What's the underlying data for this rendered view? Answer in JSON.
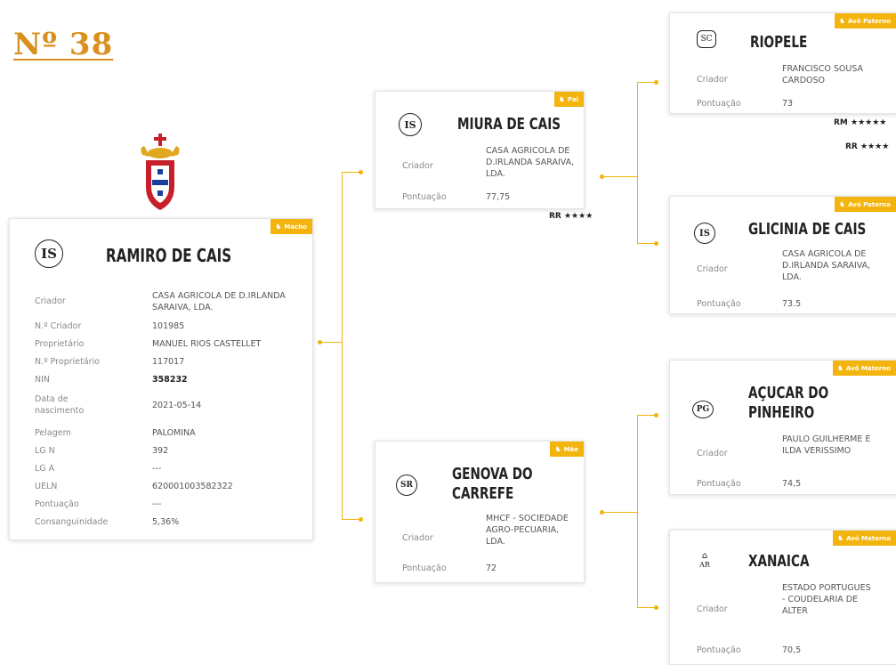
{
  "page_title": "Nº 38",
  "main": {
    "badge": "Macho",
    "name": "RAMIRO DE CAIS",
    "fields": [
      {
        "label": "Criador",
        "value": "CASA AGRICOLA DE D.IRLANDA SARAIVA, LDA."
      },
      {
        "label": "N.º Criador",
        "value": "101985"
      },
      {
        "label": "Proprietário",
        "value": "MANUEL RIOS CASTELLET"
      },
      {
        "label": "N.º Proprietário",
        "value": "117017"
      },
      {
        "label": "NIN",
        "value": "358232"
      },
      {
        "label": "Data de nascimento",
        "value": "2021-05-14"
      },
      {
        "label": "Pelagem",
        "value": "PALOMINA"
      },
      {
        "label": "LG N",
        "value": "392"
      },
      {
        "label": "LG A",
        "value": "---"
      },
      {
        "label": "UELN",
        "value": "620001003582322"
      },
      {
        "label": "Pontuação",
        "value": "---"
      },
      {
        "label": "Consanguinidade",
        "value": "5,36%"
      }
    ],
    "logo": "IS"
  },
  "sire": {
    "badge": "Pai",
    "name": "MIURA DE CAIS",
    "logo": "IS",
    "criador_label": "Criador",
    "criador": "CASA AGRICOLA DE D.IRLANDA SARAIVA, LDA.",
    "pontuacao_label": "Pontuação",
    "pontuacao": "77,75",
    "grade": "RR ★★★★"
  },
  "dam": {
    "badge": "Mãe",
    "name": "GENOVA DO CARREFE",
    "logo": "SR",
    "criador_label": "Criador",
    "criador": "MHCF - SOCIEDADE AGRO-PECUARIA, LDA.",
    "pontuacao_label": "Pontuação",
    "pontuacao": "72"
  },
  "gs1": {
    "badge": "Avô Paterno",
    "name": "RIOPELE",
    "logo": "SC",
    "criador_label": "Criador",
    "criador": "FRANCISCO SOUSA CARDOSO",
    "pontuacao_label": "Pontuação",
    "pontuacao": "73",
    "grade1": "RM ★★★★★",
    "grade2": "RR ★★★★"
  },
  "gd1": {
    "badge": "Avó Paterna",
    "name": "GLICINIA DE CAIS",
    "logo": "IS",
    "criador_label": "Criador",
    "criador": "CASA AGRICOLA DE D.IRLANDA SARAIVA, LDA.",
    "pontuacao_label": "Pontuação",
    "pontuacao": "73.5"
  },
  "gs2": {
    "badge": "Avô Materno",
    "name": "AÇUCAR DO PINHEIRO",
    "logo": "PG",
    "criador_label": "Criador",
    "criador": "PAULO GUILHERME E ILDA VERISSIMO",
    "pontuacao_label": "Pontuação",
    "pontuacao": "74,5"
  },
  "gd2": {
    "badge": "Avó Materna",
    "name": "XANAICA",
    "logo": "AR",
    "criador_label": "Criador",
    "criador": "ESTADO PORTUGUES - COUDELARIA DE ALTER",
    "pontuacao_label": "Pontuação",
    "pontuacao": "70,5"
  },
  "colors": {
    "accent": "#f2b40d",
    "title": "#d9901e"
  }
}
